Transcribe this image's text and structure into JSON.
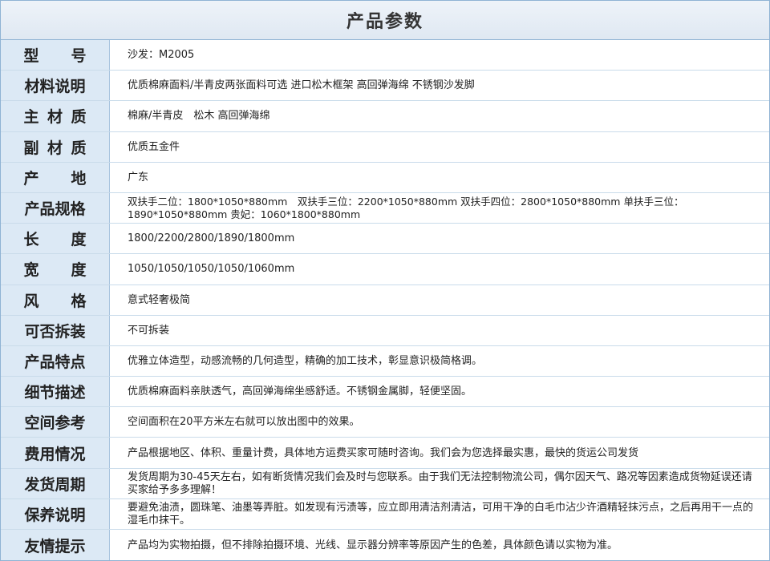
{
  "title": "产品参数",
  "rows": [
    {
      "label": "型　　号",
      "label_chars": [
        "型",
        "号"
      ],
      "value": "沙发：M2005"
    },
    {
      "label": "材料说明",
      "value": "优质棉麻面料/半青皮两张面料可选 进口松木框架 高回弹海绵 不锈钢沙发脚"
    },
    {
      "label": "主 材 质",
      "label_chars": [
        "主",
        "材",
        "质"
      ],
      "value": "棉麻/半青皮　松木 高回弹海绵"
    },
    {
      "label": "副 材 质",
      "label_chars": [
        "副",
        "材",
        "质"
      ],
      "value": "优质五金件"
    },
    {
      "label": "产　　地",
      "label_chars": [
        "产",
        "地"
      ],
      "value": "广东"
    },
    {
      "label": "产品规格",
      "value": "双扶手二位：1800*1050*880mm　双扶手三位：2200*1050*880mm 双扶手四位：2800*1050*880mm 单扶手三位：1890*1050*880mm 贵妃：1060*1800*880mm"
    },
    {
      "label": "长　　度",
      "label_chars": [
        "长",
        "度"
      ],
      "value": "1800/2200/2800/1890/1800mm"
    },
    {
      "label": "宽　　度",
      "label_chars": [
        "宽",
        "度"
      ],
      "value": "1050/1050/1050/1050/1060mm"
    },
    {
      "label": "风　　格",
      "label_chars": [
        "风",
        "格"
      ],
      "value": "意式轻奢极简"
    },
    {
      "label": "可否拆装",
      "value": "不可拆装"
    },
    {
      "label": "产品特点",
      "value": "优雅立体造型，动感流畅的几何造型，精确的加工技术，彰显意识极简格调。"
    },
    {
      "label": "细节描述",
      "value": "优质棉麻面料亲肤透气，高回弹海绵坐感舒适。不锈钢金属脚，轻便坚固。"
    },
    {
      "label": "空间参考",
      "value": "空间面积在20平方米左右就可以放出图中的效果。"
    },
    {
      "label": "费用情况",
      "value": "产品根据地区、体积、重量计费，具体地方运费买家可随时咨询。我们会为您选择最实惠，最快的货运公司发货"
    },
    {
      "label": "发货周期",
      "value": "发货周期为30-45天左右，如有断货情况我们会及时与您联系。由于我们无法控制物流公司，偶尔因天气、路况等因素造成货物延误还请买家给予多多理解！"
    },
    {
      "label": "保养说明",
      "value": "要避免油渍，圆珠笔、油墨等弄脏。如发现有污渍等，应立即用清洁剂清洁，可用干净的白毛巾沾少许酒精轻抹污点，之后再用干一点的湿毛巾抹干。"
    },
    {
      "label": "友情提示",
      "value": "产品均为实物拍摄，但不排除拍摄环境、光线、显示器分辨率等原因产生的色差，具体颜色请以实物为准。"
    }
  ]
}
